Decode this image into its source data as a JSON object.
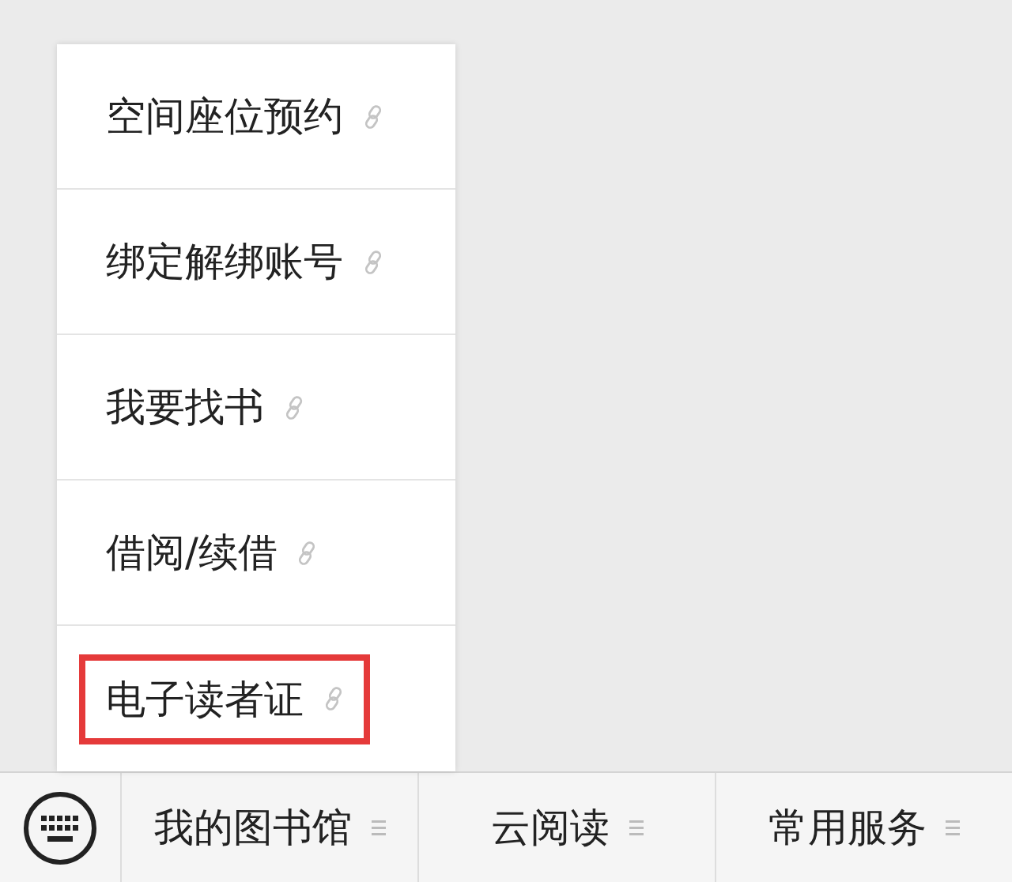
{
  "menu_popup": {
    "items": [
      {
        "label": "空间座位预约",
        "highlighted": false
      },
      {
        "label": "绑定解绑账号",
        "highlighted": false
      },
      {
        "label": "我要找书",
        "highlighted": false
      },
      {
        "label": "借阅/续借",
        "highlighted": false
      },
      {
        "label": "电子读者证",
        "highlighted": true
      }
    ]
  },
  "bottom_menu": {
    "tabs": [
      {
        "label": "我的图书馆"
      },
      {
        "label": "云阅读"
      },
      {
        "label": "常用服务"
      }
    ]
  }
}
